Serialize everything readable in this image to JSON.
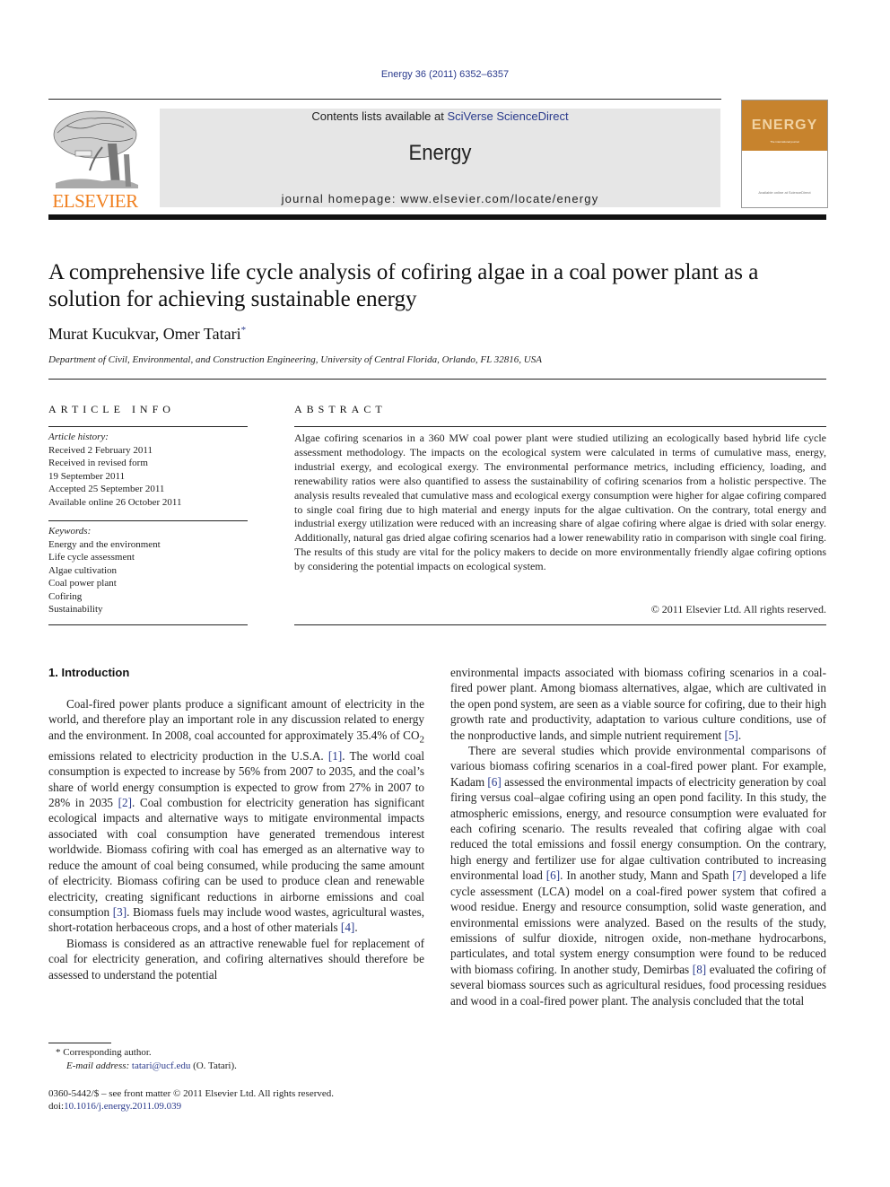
{
  "header": {
    "journal_ref": "Energy 36 (2011) 6352–6357",
    "contents_prefix": "Contents lists available at ",
    "contents_link": "SciVerse ScienceDirect",
    "journal_name": "Energy",
    "homepage": "journal homepage: www.elsevier.com/locate/energy",
    "publisher_logo_text": "ELSEVIER",
    "cover_title": "ENERGY",
    "cover_subtitle": "The international journal",
    "cover_footer": "Available online at ScienceDirect",
    "colors": {
      "elsevier_orange": "#f07f1e",
      "cover_orange": "#c7832d",
      "link_blue": "#2a3a8c",
      "header_gray": "#e6e6e6"
    }
  },
  "article": {
    "title": "A comprehensive life cycle analysis of cofiring algae in a coal power plant as a solution for achieving sustainable energy",
    "authors": "Murat Kucukvar, Omer Tatari",
    "author_mark": "*",
    "affiliation": "Department of Civil, Environmental, and Construction Engineering, University of Central Florida, Orlando, FL 32816, USA"
  },
  "article_info": {
    "heading": "ARTICLE INFO",
    "history_label": "Article history:",
    "history": [
      "Received 2 February 2011",
      "Received in revised form",
      "19 September 2011",
      "Accepted 25 September 2011",
      "Available online 26 October 2011"
    ],
    "keywords_label": "Keywords:",
    "keywords": [
      "Energy and the environment",
      "Life cycle assessment",
      "Algae cultivation",
      "Coal power plant",
      "Cofiring",
      "Sustainability"
    ]
  },
  "abstract": {
    "heading": "ABSTRACT",
    "text": "Algae cofiring scenarios in a 360 MW coal power plant were studied utilizing an ecologically based hybrid life cycle assessment methodology. The impacts on the ecological system were calculated in terms of cumulative mass, energy, industrial exergy, and ecological exergy. The environmental performance metrics, including efficiency, loading, and renewability ratios were also quantified to assess the sustainability of cofiring scenarios from a holistic perspective. The analysis results revealed that cumulative mass and ecological exergy consumption were higher for algae cofiring compared to single coal firing due to high material and energy inputs for the algae cultivation. On the contrary, total energy and industrial exergy utilization were reduced with an increasing share of algae cofiring where algae is dried with solar energy. Additionally, natural gas dried algae cofiring scenarios had a lower renewability ratio in comparison with single coal firing. The results of this study are vital for the policy makers to decide on more environmentally friendly algae cofiring options by considering the potential impacts on ecological system.",
    "copyright": "© 2011 Elsevier Ltd. All rights reserved."
  },
  "body": {
    "section_heading": "1.  Introduction",
    "left": {
      "p1_a": "Coal-fired power plants produce a significant amount of electricity in the world, and therefore play an important role in any discussion related to energy and the environment. In 2008, coal accounted for approximately 35.4% of CO",
      "p1_sub": "2",
      "p1_b": " emissions related to electricity production in the U.S.A. ",
      "ref1": "[1]",
      "p1_c": ". The world coal consumption is expected to increase by 56% from 2007 to 2035, and the coal’s share of world energy consumption is expected to grow from 27% in 2007 to 28% in 2035 ",
      "ref2": "[2]",
      "p1_d": ". Coal combustion for electricity generation has significant ecological impacts and alternative ways to mitigate environmental impacts associated with coal consumption have generated tremendous interest worldwide. Biomass cofiring with coal has emerged as an alternative way to reduce the amount of coal being consumed, while producing the same amount of electricity. Biomass cofiring can be used to produce clean and renewable electricity, creating significant reductions in airborne emissions and coal consumption ",
      "ref3": "[3]",
      "p1_e": ". Biomass fuels may include wood wastes, agricultural wastes, short-rotation herbaceous crops, and a host of other materials ",
      "ref4": "[4]",
      "p1_f": ".",
      "p2": "Biomass is considered as an attractive renewable fuel for replacement of coal for electricity generation, and cofiring alternatives should therefore be assessed to understand the potential"
    },
    "right": {
      "p1_a": "environmental impacts associated with biomass cofiring scenarios in a coal-fired power plant. Among biomass alternatives, algae, which are cultivated in the open pond system, are seen as a viable source for cofiring, due to their high growth rate and productivity, adaptation to various culture conditions, use of the nonproductive lands, and simple nutrient requirement ",
      "ref5": "[5]",
      "p1_b": ".",
      "p2_a": "There are several studies which provide environmental comparisons of various biomass cofiring scenarios in a coal-fired power plant. For example, Kadam ",
      "ref6a": "[6]",
      "p2_b": " assessed the environmental impacts of electricity generation by coal firing versus coal–algae cofiring using an open pond facility. In this study, the atmospheric emissions, energy, and resource consumption were evaluated for each cofiring scenario. The results revealed that cofiring algae with coal reduced the total emissions and fossil energy consumption. On the contrary, high energy and fertilizer use for algae cultivation contributed to increasing environmental load ",
      "ref6b": "[6]",
      "p2_c": ". In another study, Mann and Spath ",
      "ref7": "[7]",
      "p2_d": " developed a life cycle assessment (LCA) model on a coal-fired power system that cofired a wood residue. Energy and resource consumption, solid waste generation, and environmental emissions were analyzed. Based on the results of the study, emissions of sulfur dioxide, nitrogen oxide, non-methane hydrocarbons, particulates, and total system energy consumption were found to be reduced with biomass cofiring. In another study, Demirbas ",
      "ref8": "[8]",
      "p2_e": " evaluated the cofiring of several biomass sources such as agricultural residues, food processing residues and wood in a coal-fired power plant. The analysis concluded that the total"
    }
  },
  "footnotes": {
    "corresponding": "* Corresponding author.",
    "email_label": "E-mail address:",
    "email": "tatari@ucf.edu",
    "email_suffix": " (O. Tatari).",
    "issn_line": "0360-5442/$ – see front matter © 2011 Elsevier Ltd. All rights reserved.",
    "doi_prefix": "doi:",
    "doi": "10.1016/j.energy.2011.09.039"
  }
}
